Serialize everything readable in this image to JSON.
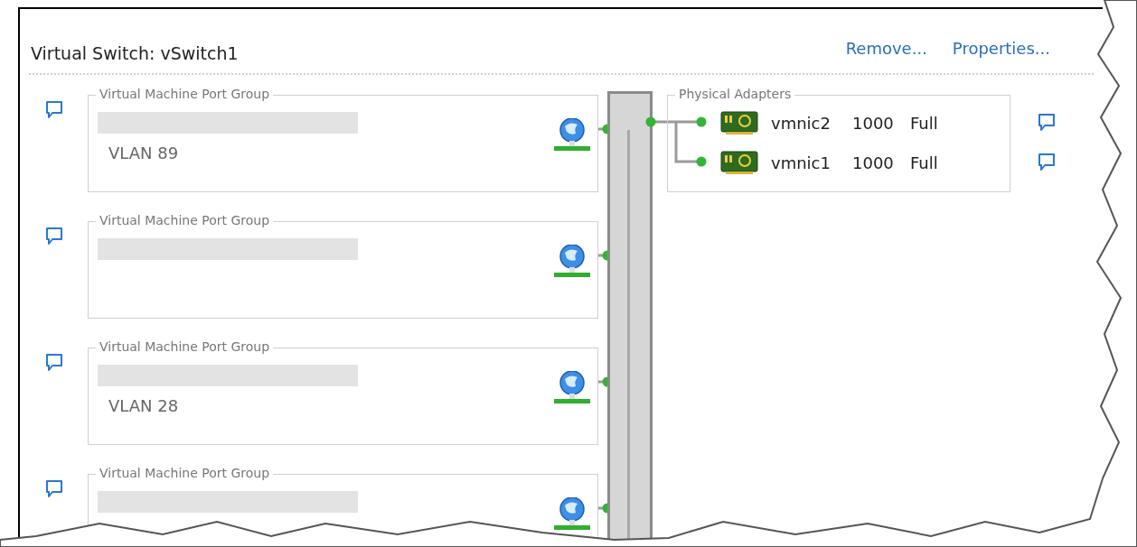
{
  "header": {
    "title": "Virtual Switch: vSwitch1",
    "links": [
      "Remove...",
      "Properties..."
    ]
  },
  "port_groups": [
    {
      "label": "Virtual Machine Port Group",
      "vlan": "VLAN 89"
    },
    {
      "label": "Virtual Machine Port Group"
    },
    {
      "label": "Virtual Machine Port Group",
      "vlan": "VLAN 28"
    },
    {
      "label": "Virtual Machine Port Group"
    }
  ],
  "physical_adapters": {
    "label": "Physical Adapters",
    "adapters": [
      {
        "name": "vmnic2",
        "speed": "1000",
        "duplex": "Full"
      },
      {
        "name": "vmnic1",
        "speed": "1000",
        "duplex": "Full"
      }
    ]
  }
}
